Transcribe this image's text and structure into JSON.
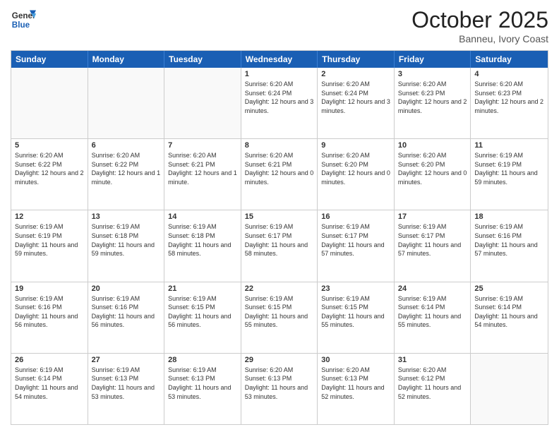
{
  "logo": {
    "line1": "General",
    "line2": "Blue"
  },
  "title": "October 2025",
  "subtitle": "Banneu, Ivory Coast",
  "days": [
    "Sunday",
    "Monday",
    "Tuesday",
    "Wednesday",
    "Thursday",
    "Friday",
    "Saturday"
  ],
  "rows": [
    [
      {
        "day": "",
        "info": ""
      },
      {
        "day": "",
        "info": ""
      },
      {
        "day": "",
        "info": ""
      },
      {
        "day": "1",
        "info": "Sunrise: 6:20 AM\nSunset: 6:24 PM\nDaylight: 12 hours and 3 minutes."
      },
      {
        "day": "2",
        "info": "Sunrise: 6:20 AM\nSunset: 6:24 PM\nDaylight: 12 hours and 3 minutes."
      },
      {
        "day": "3",
        "info": "Sunrise: 6:20 AM\nSunset: 6:23 PM\nDaylight: 12 hours and 2 minutes."
      },
      {
        "day": "4",
        "info": "Sunrise: 6:20 AM\nSunset: 6:23 PM\nDaylight: 12 hours and 2 minutes."
      }
    ],
    [
      {
        "day": "5",
        "info": "Sunrise: 6:20 AM\nSunset: 6:22 PM\nDaylight: 12 hours and 2 minutes."
      },
      {
        "day": "6",
        "info": "Sunrise: 6:20 AM\nSunset: 6:22 PM\nDaylight: 12 hours and 1 minute."
      },
      {
        "day": "7",
        "info": "Sunrise: 6:20 AM\nSunset: 6:21 PM\nDaylight: 12 hours and 1 minute."
      },
      {
        "day": "8",
        "info": "Sunrise: 6:20 AM\nSunset: 6:21 PM\nDaylight: 12 hours and 0 minutes."
      },
      {
        "day": "9",
        "info": "Sunrise: 6:20 AM\nSunset: 6:20 PM\nDaylight: 12 hours and 0 minutes."
      },
      {
        "day": "10",
        "info": "Sunrise: 6:20 AM\nSunset: 6:20 PM\nDaylight: 12 hours and 0 minutes."
      },
      {
        "day": "11",
        "info": "Sunrise: 6:19 AM\nSunset: 6:19 PM\nDaylight: 11 hours and 59 minutes."
      }
    ],
    [
      {
        "day": "12",
        "info": "Sunrise: 6:19 AM\nSunset: 6:19 PM\nDaylight: 11 hours and 59 minutes."
      },
      {
        "day": "13",
        "info": "Sunrise: 6:19 AM\nSunset: 6:18 PM\nDaylight: 11 hours and 59 minutes."
      },
      {
        "day": "14",
        "info": "Sunrise: 6:19 AM\nSunset: 6:18 PM\nDaylight: 11 hours and 58 minutes."
      },
      {
        "day": "15",
        "info": "Sunrise: 6:19 AM\nSunset: 6:17 PM\nDaylight: 11 hours and 58 minutes."
      },
      {
        "day": "16",
        "info": "Sunrise: 6:19 AM\nSunset: 6:17 PM\nDaylight: 11 hours and 57 minutes."
      },
      {
        "day": "17",
        "info": "Sunrise: 6:19 AM\nSunset: 6:17 PM\nDaylight: 11 hours and 57 minutes."
      },
      {
        "day": "18",
        "info": "Sunrise: 6:19 AM\nSunset: 6:16 PM\nDaylight: 11 hours and 57 minutes."
      }
    ],
    [
      {
        "day": "19",
        "info": "Sunrise: 6:19 AM\nSunset: 6:16 PM\nDaylight: 11 hours and 56 minutes."
      },
      {
        "day": "20",
        "info": "Sunrise: 6:19 AM\nSunset: 6:16 PM\nDaylight: 11 hours and 56 minutes."
      },
      {
        "day": "21",
        "info": "Sunrise: 6:19 AM\nSunset: 6:15 PM\nDaylight: 11 hours and 56 minutes."
      },
      {
        "day": "22",
        "info": "Sunrise: 6:19 AM\nSunset: 6:15 PM\nDaylight: 11 hours and 55 minutes."
      },
      {
        "day": "23",
        "info": "Sunrise: 6:19 AM\nSunset: 6:15 PM\nDaylight: 11 hours and 55 minutes."
      },
      {
        "day": "24",
        "info": "Sunrise: 6:19 AM\nSunset: 6:14 PM\nDaylight: 11 hours and 55 minutes."
      },
      {
        "day": "25",
        "info": "Sunrise: 6:19 AM\nSunset: 6:14 PM\nDaylight: 11 hours and 54 minutes."
      }
    ],
    [
      {
        "day": "26",
        "info": "Sunrise: 6:19 AM\nSunset: 6:14 PM\nDaylight: 11 hours and 54 minutes."
      },
      {
        "day": "27",
        "info": "Sunrise: 6:19 AM\nSunset: 6:13 PM\nDaylight: 11 hours and 53 minutes."
      },
      {
        "day": "28",
        "info": "Sunrise: 6:19 AM\nSunset: 6:13 PM\nDaylight: 11 hours and 53 minutes."
      },
      {
        "day": "29",
        "info": "Sunrise: 6:20 AM\nSunset: 6:13 PM\nDaylight: 11 hours and 53 minutes."
      },
      {
        "day": "30",
        "info": "Sunrise: 6:20 AM\nSunset: 6:13 PM\nDaylight: 11 hours and 52 minutes."
      },
      {
        "day": "31",
        "info": "Sunrise: 6:20 AM\nSunset: 6:12 PM\nDaylight: 11 hours and 52 minutes."
      },
      {
        "day": "",
        "info": ""
      }
    ]
  ]
}
